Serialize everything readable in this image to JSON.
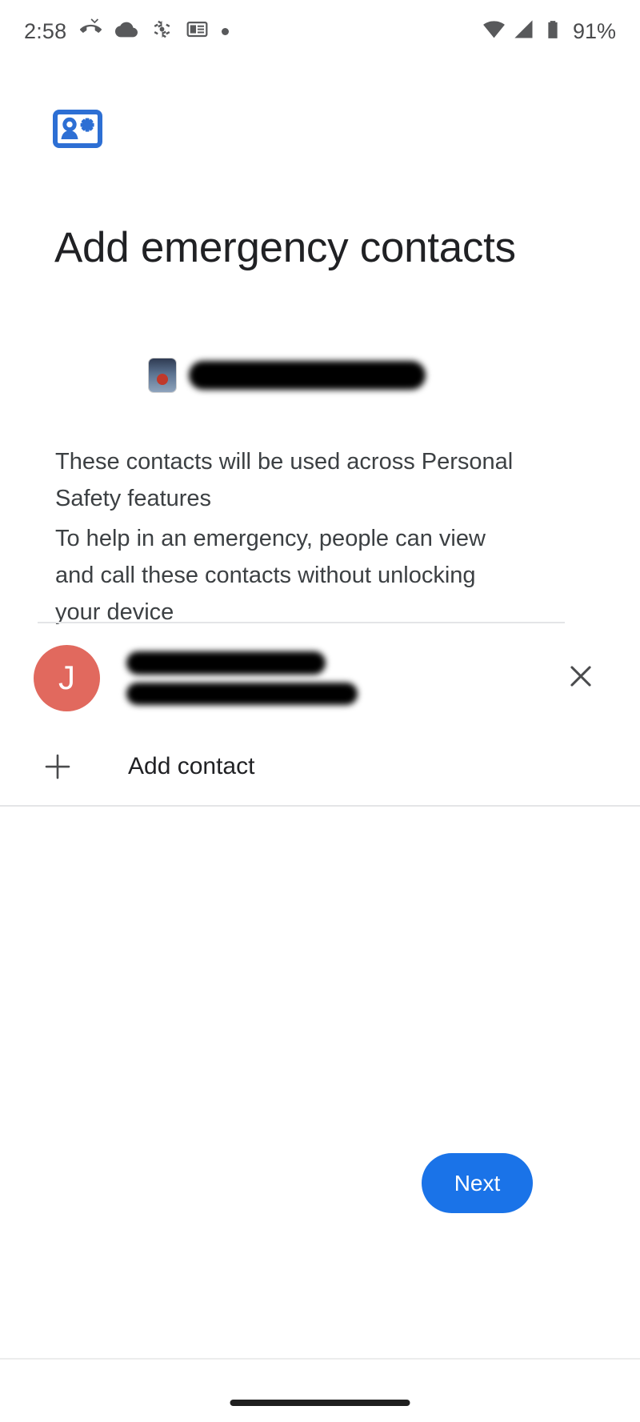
{
  "status_bar": {
    "time": "2:58",
    "battery_percent": "91%",
    "left_icons": [
      "missed-call-icon",
      "cloud-icon",
      "bluetooth-share-icon",
      "news-card-icon",
      "dot-icon"
    ],
    "right_icons": [
      "wifi-icon",
      "cellular-signal-icon",
      "battery-icon"
    ],
    "icon_color": "#58595b"
  },
  "header": {
    "icon": "contact-card-star-icon",
    "icon_color": "#1a73e8",
    "title": "Add emergency contacts"
  },
  "account": {
    "avatar": "account-photo-avatar",
    "name_redacted": true,
    "redacted_label": ""
  },
  "body": {
    "paragraph_1": "These contacts will be used across Personal Safety features",
    "paragraph_2": "To help in an emergency, people can view and call these contacts without unlocking your device"
  },
  "contact_list": {
    "items": [
      {
        "avatar_initial": "J",
        "avatar_color": "#e1695e",
        "name_redacted": true,
        "subtitle_redacted": true,
        "remove_icon": "close-icon"
      }
    ],
    "add_contact": {
      "icon": "plus-icon",
      "label": "Add contact"
    }
  },
  "footer": {
    "next_label": "Next",
    "next_color": "#1a73e8"
  },
  "navigation": {
    "gesture_bar": "home-gesture-bar"
  }
}
